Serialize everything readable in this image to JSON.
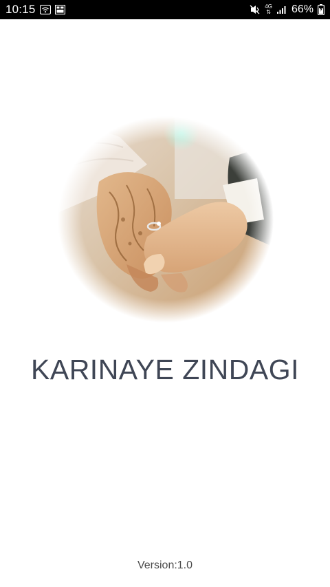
{
  "status_bar": {
    "time": "10:15",
    "network": "4G",
    "battery": "66%",
    "icons": [
      "wifi-hotspot-icon",
      "image-notification-icon",
      "mute-vibrate-icon",
      "network-type-icon",
      "signal-icon",
      "battery-icon"
    ]
  },
  "splash": {
    "image_icon": "wedding-hands-photo",
    "title": "KARINAYE ZINDAGI",
    "version": "Version:1.0"
  },
  "colors": {
    "status_bar_bg": "#000000",
    "background": "#ffffff",
    "title_text": "#3f4655",
    "version_text": "#4a4a4a"
  }
}
